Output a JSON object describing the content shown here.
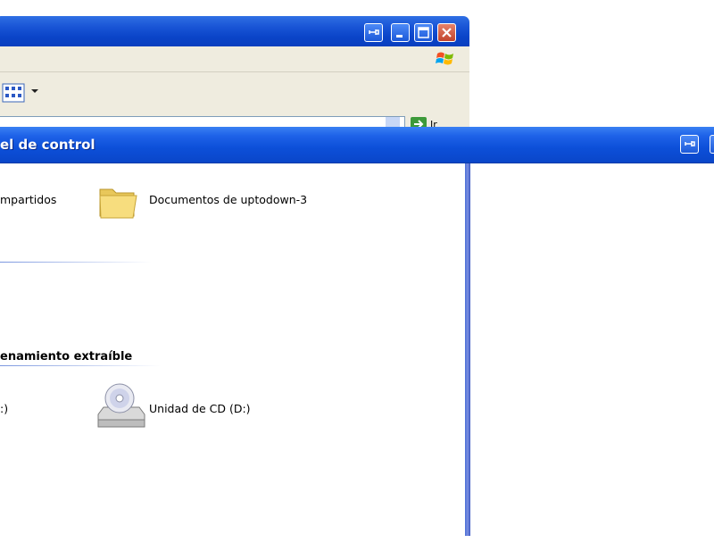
{
  "front_window": {
    "title": "el de control"
  },
  "back_window": {
    "go_label": "Ir",
    "files_section": {
      "items": [
        {
          "label": "mpartidos"
        },
        {
          "label": "Documentos de uptodown-3"
        }
      ]
    },
    "removable_section": {
      "title": "enamiento extraíble",
      "items": [
        {
          "label": ":)"
        },
        {
          "label": "Unidad de CD (D:)"
        }
      ]
    }
  },
  "colors": {
    "titlebar_blue": "#0a46c9",
    "menu_bg": "#efecdf",
    "section_line": "#7a96df"
  },
  "icons": [
    "pin-icon",
    "minimize-icon",
    "maximize-icon",
    "close-icon",
    "windows-flag-icon",
    "views-icon",
    "go-arrow-icon",
    "folder-icon",
    "cd-drive-icon"
  ]
}
